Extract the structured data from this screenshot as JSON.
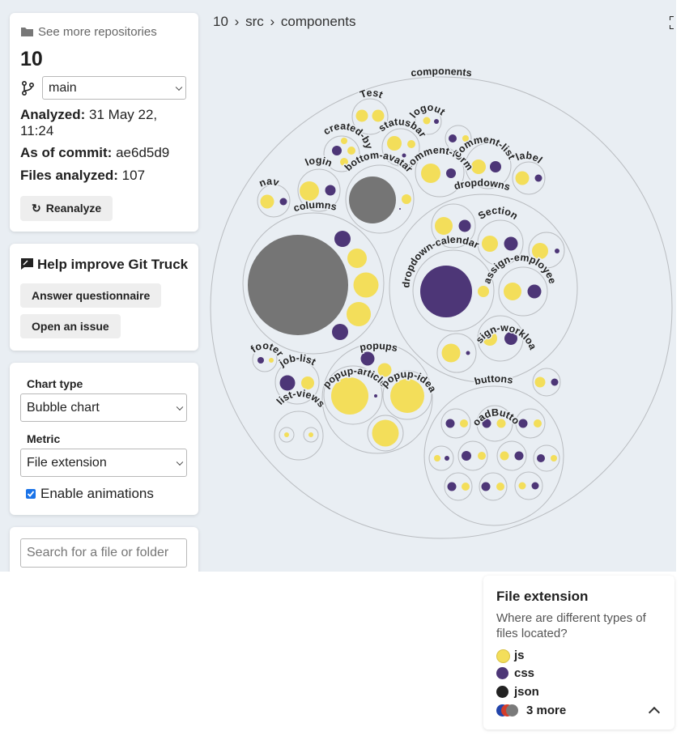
{
  "breadcrumb": {
    "root": "10",
    "sep1": "›",
    "mid": "src",
    "sep2": "›",
    "current": "components"
  },
  "repo": {
    "see_more": "See more repositories",
    "name": "10",
    "branch": "main",
    "analyzed_label": "Analyzed:",
    "analyzed_value_line1": "31 May 22,",
    "analyzed_value_line2": "11:24",
    "commit_label": "As of commit:",
    "commit_value": "ae6d5d9",
    "files_label": "Files analyzed:",
    "files_value": "107",
    "reanalyze": "Reanalyze"
  },
  "help": {
    "title": "Help improve Git Truck",
    "questionnaire": "Answer questionnaire",
    "issue": "Open an issue"
  },
  "options": {
    "chart_type_label": "Chart type",
    "chart_type_value": "Bubble chart",
    "metric_label": "Metric",
    "metric_value": "File extension",
    "animations_label": "Enable animations",
    "animations_checked": true
  },
  "search": {
    "placeholder": "Search for a file or folder"
  },
  "legend": {
    "title": "File extension",
    "description": "Where are different types of files located?",
    "items": [
      {
        "label": "js",
        "color": "#f3de5a"
      },
      {
        "label": "css",
        "color": "#4d3677"
      },
      {
        "label": "json",
        "color": "#222222"
      }
    ],
    "more": "3 more"
  },
  "colors": {
    "js": "#f3de5a",
    "css": "#4d3677",
    "json": "#222222",
    "other": "#757575"
  },
  "chart_data": {
    "type": "bubble",
    "folders": [
      "components",
      "Test",
      "logout",
      "statusbar",
      "created-by",
      "comment-form",
      "comment-list",
      "label",
      "nav",
      "login",
      "bottom-avatar",
      "dropdowns",
      "columns",
      "Section",
      "dropdown-calendar",
      "assign-employee",
      "assign-workload",
      "footer",
      "job-list",
      "popups",
      "popup-article",
      "popup-idea",
      "list-views",
      "buttons",
      "LoadButton"
    ]
  }
}
